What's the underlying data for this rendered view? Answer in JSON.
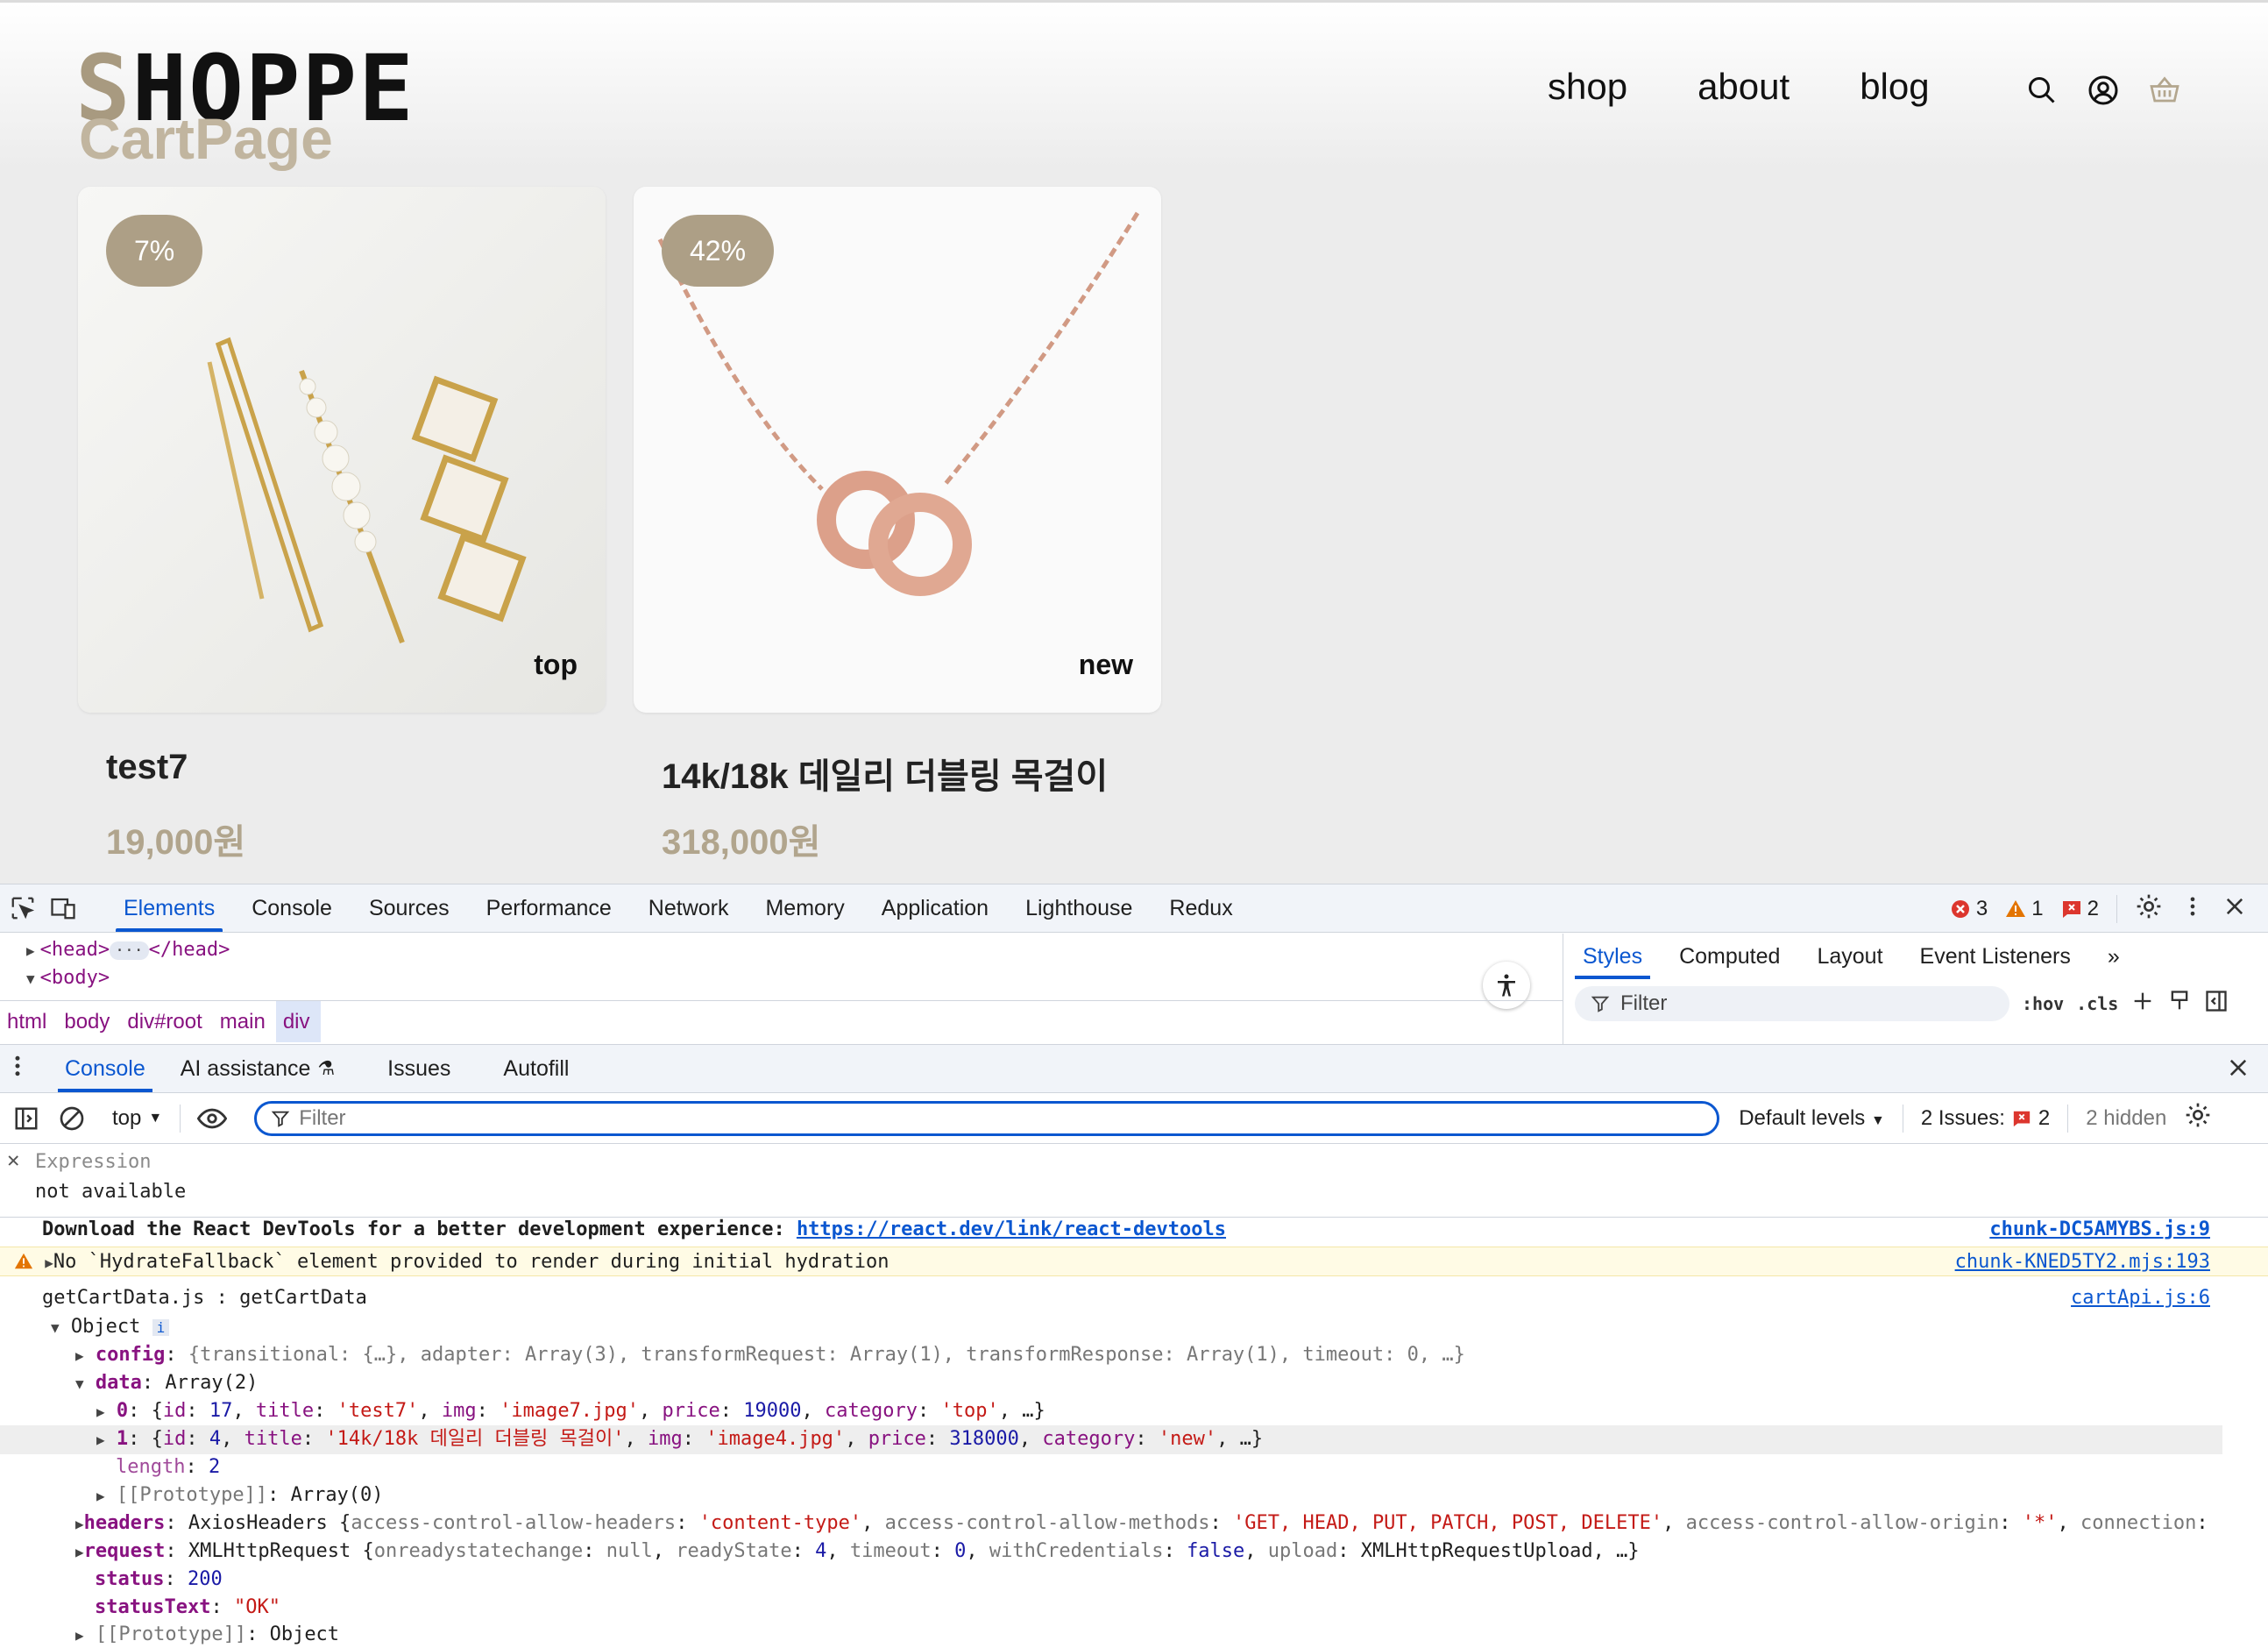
{
  "shop": {
    "logo": "SHOPPE",
    "logo_first": "S",
    "logo_rest": "HOPPE",
    "subtitle": "CartPage",
    "nav": [
      "shop",
      "about",
      "blog"
    ],
    "icons": [
      "search-icon",
      "user-icon",
      "cart-icon"
    ],
    "products": [
      {
        "badge": "7%",
        "tag": "top",
        "title": "test7",
        "price": "19,000원"
      },
      {
        "badge": "42%",
        "tag": "new",
        "title": "14k/18k 데일리 더블링 목걸이",
        "price": "318,000원"
      }
    ],
    "accent": "#ad9f86"
  },
  "devtools": {
    "tabs": [
      "Elements",
      "Console",
      "Sources",
      "Performance",
      "Network",
      "Memory",
      "Application",
      "Lighthouse",
      "Redux"
    ],
    "active_tab": "Elements",
    "errors": "3",
    "warnings": "1",
    "issues": "2",
    "dom_lines": [
      "<head>",
      "</head>",
      "<body>"
    ],
    "breadcrumb": [
      "html",
      "body",
      "div#root",
      "main",
      "div"
    ],
    "styles_tabs": [
      "Styles",
      "Computed",
      "Layout",
      "Event Listeners"
    ],
    "styles_filter": "Filter",
    "hov": ":hov",
    "cls": ".cls",
    "drawer_tabs": [
      "Console",
      "AI assistance",
      "Issues",
      "Autofill"
    ],
    "console": {
      "context": "top",
      "filter_placeholder": "Filter",
      "levels": "Default levels",
      "issues_label": "2 Issues:",
      "issues_count": "2",
      "hidden": "2 hidden",
      "expression_label": "Expression",
      "expression_value": "not available",
      "logs": {
        "l1": "Download the React DevTools for a better development experience: ",
        "l1_link": "https://react.dev/link/react-devtools",
        "l1_src": "chunk-DC5AMYBS.js:9",
        "l2": "No `HydrateFallback` element provided to render during initial hydration",
        "l2_src": "chunk-KNED5TY2.mjs:193",
        "l3": "getCartData.js : getCartData",
        "l3_src": "cartApi.js:6",
        "obj": "Object",
        "config": "{transitional: {…}, adapter: Array(3), transformRequest: Array(1), transformResponse: Array(1), timeout: 0, …}",
        "data_val": "Array(2)",
        "item0": {
          "id": "17",
          "title": "'test7'",
          "img": "'image7.jpg'",
          "price": "19000",
          "category": "'top'"
        },
        "item1": {
          "id": "4",
          "title": "'14k/18k 데일리 더블링 목걸이'",
          "img": "'image4.jpg'",
          "price": "318000",
          "category": "'new'"
        },
        "length": "2",
        "proto_arr": "Array(0)",
        "headers_type": "AxiosHeaders",
        "h_allow_headers": "'content-type'",
        "h_allow_methods": "'GET, HEAD, PUT, PATCH, POST, DELETE'",
        "h_allow_origin": "'*'",
        "request_type": "XMLHttpRequest",
        "status": "200",
        "statusText": "\"OK\"",
        "proto_obj": "Object"
      }
    }
  }
}
